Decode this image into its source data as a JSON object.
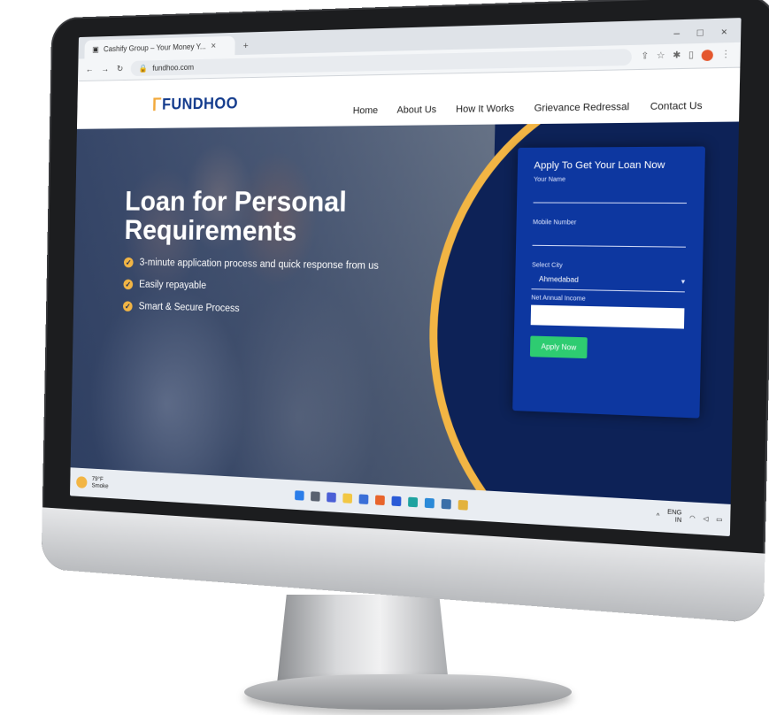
{
  "browser": {
    "tab_title": "Cashify Group – Your Money Y...",
    "url": "fundhoo.com"
  },
  "site": {
    "logo_text": "FUNDHOO",
    "nav": [
      "Home",
      "About Us",
      "How It Works",
      "Grievance Redressal",
      "Contact Us"
    ]
  },
  "hero": {
    "title": "Loan for Personal Requirements",
    "features": [
      "3-minute application process and quick response from us",
      "Easily repayable",
      "Smart & Secure Process"
    ]
  },
  "form": {
    "title": "Apply To Get Your Loan Now",
    "name_label": "Your Name",
    "mobile_label": "Mobile Number",
    "city_label": "Select City",
    "city_value": "Ahmedabad",
    "income_label": "Net Annual Income",
    "button_label": "Apply Now"
  },
  "taskbar": {
    "weather_temp": "79°F",
    "weather_desc": "Smoke",
    "lang": "ENG",
    "region": "IN"
  },
  "colors": {
    "brand_blue": "#123a8c",
    "accent_yellow": "#f2b544",
    "form_blue": "#0d37a0",
    "button_green": "#2ecc71"
  }
}
